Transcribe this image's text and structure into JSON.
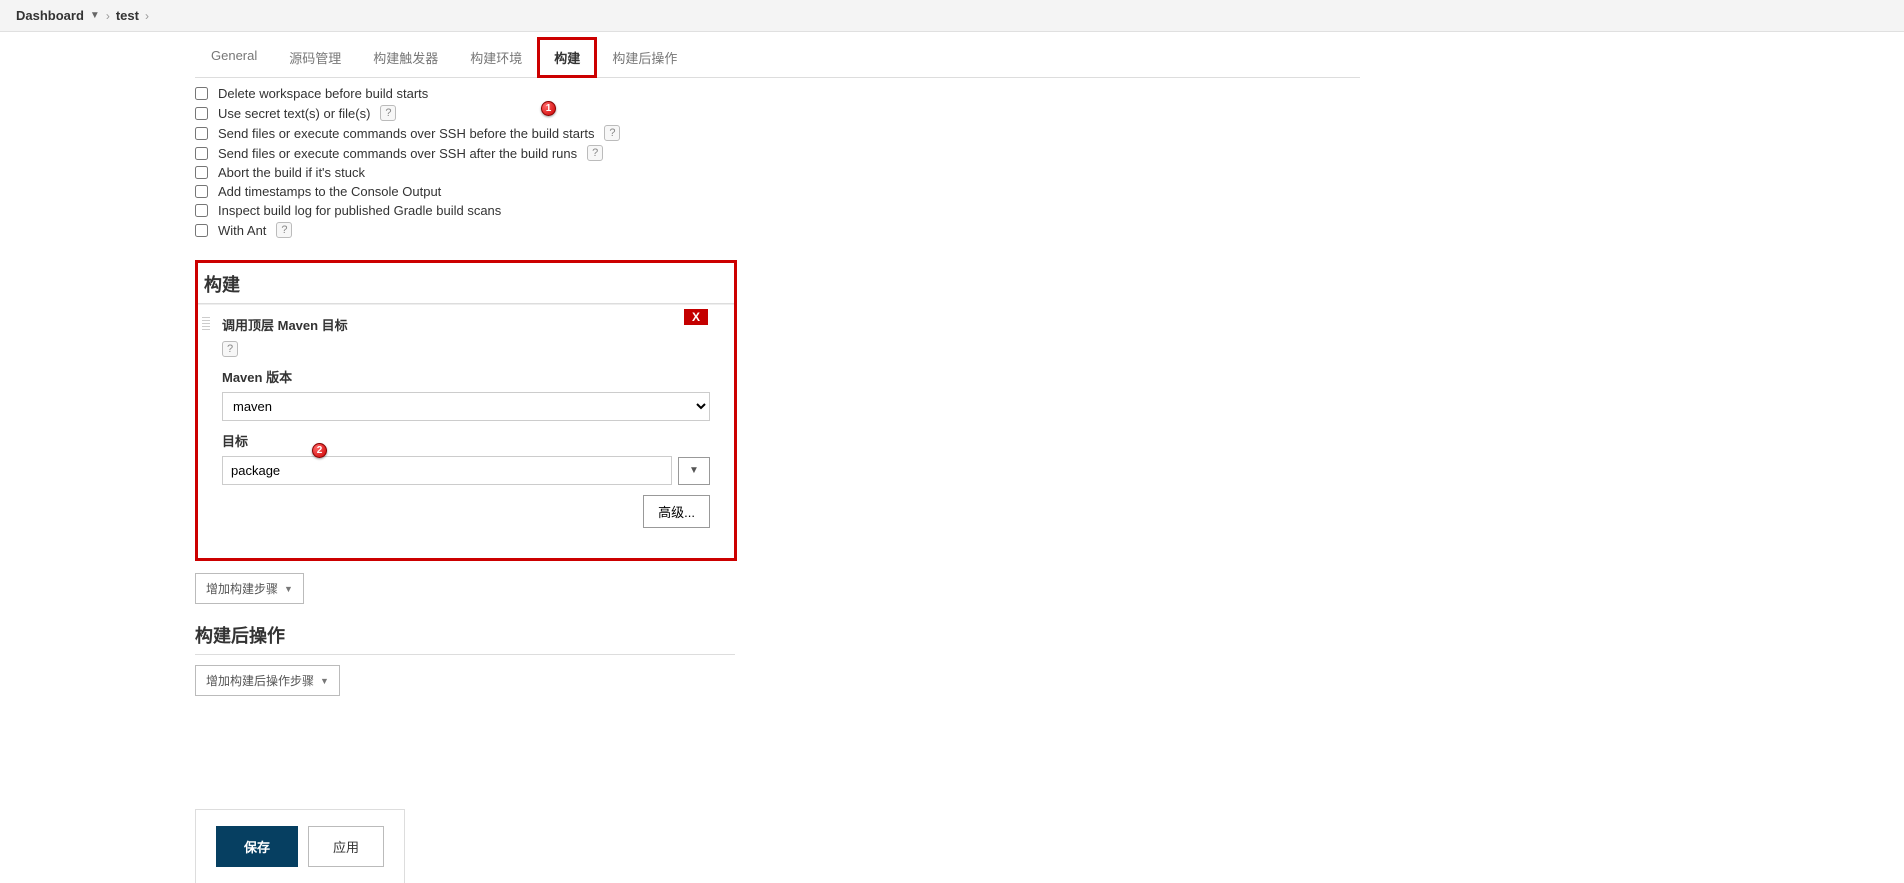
{
  "breadcrumb": {
    "dashboard": "Dashboard",
    "project": "test"
  },
  "tabs": [
    {
      "label": "General"
    },
    {
      "label": "源码管理"
    },
    {
      "label": "构建触发器"
    },
    {
      "label": "构建环境"
    },
    {
      "label": "构建",
      "active": true,
      "highlighted": true
    },
    {
      "label": "构建后操作"
    }
  ],
  "build_env_checkboxes": [
    {
      "label": "Delete workspace before build starts",
      "help": false
    },
    {
      "label": "Use secret text(s) or file(s)",
      "help": true
    },
    {
      "label": "Send files or execute commands over SSH before the build starts",
      "help": true
    },
    {
      "label": "Send files or execute commands over SSH after the build runs",
      "help": true
    },
    {
      "label": "Abort the build if it's stuck",
      "help": false
    },
    {
      "label": "Add timestamps to the Console Output",
      "help": false
    },
    {
      "label": "Inspect build log for published Gradle build scans",
      "help": false
    },
    {
      "label": "With Ant",
      "help": true
    }
  ],
  "build_section": {
    "title": "构建",
    "step_title": "调用顶层 Maven 目标",
    "close_label": "X",
    "maven_version_label": "Maven 版本",
    "maven_version_value": "maven",
    "target_label": "目标",
    "target_value": "package",
    "advanced_label": "高级..."
  },
  "callouts": {
    "one": "1",
    "two": "2"
  },
  "add_build_step_label": "增加构建步骤",
  "post_build_title": "构建后操作",
  "add_post_build_step_label": "增加构建后操作步骤",
  "buttons": {
    "save": "保存",
    "apply": "应用"
  },
  "help_char": "?"
}
